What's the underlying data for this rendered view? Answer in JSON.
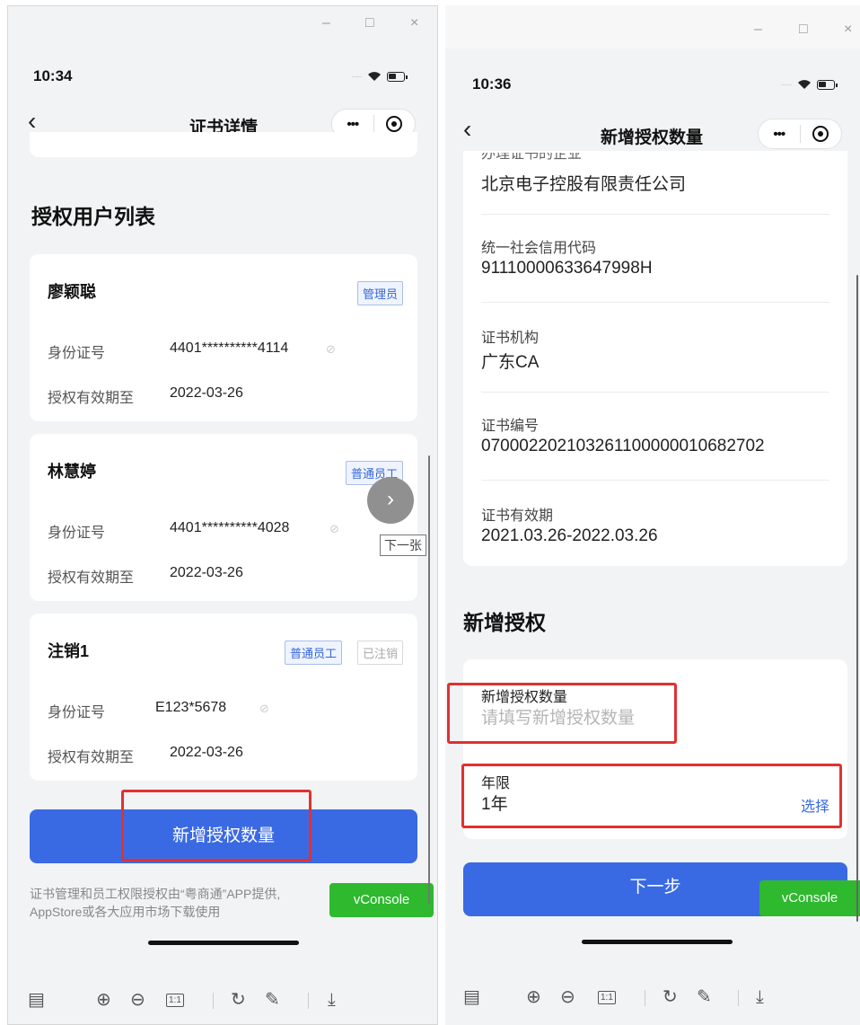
{
  "left": {
    "status_time": "10:34",
    "nav_title": "证书详情",
    "section_title": "授权用户列表",
    "users": [
      {
        "name": "廖颖聪",
        "tags": [
          {
            "text": "管理员",
            "style": "blue"
          }
        ],
        "id_label": "身份证号",
        "id_value": "4401**********4114",
        "expiry_label": "授权有效期至",
        "expiry_value": "2022-03-26"
      },
      {
        "name": "林慧婷",
        "tags": [
          {
            "text": "普通员工",
            "style": "blue"
          }
        ],
        "id_label": "身份证号",
        "id_value": "4401**********4028",
        "expiry_label": "授权有效期至",
        "expiry_value": "2022-03-26"
      },
      {
        "name": "注销1",
        "tags": [
          {
            "text": "普通员工",
            "style": "blue"
          },
          {
            "text": "已注销",
            "style": "gray"
          }
        ],
        "id_label": "身份证号",
        "id_value": "E123*5678",
        "expiry_label": "授权有效期至",
        "expiry_value": "2022-03-26"
      }
    ],
    "add_button": "新增授权数量",
    "footer_line1": "证书管理和员工权限授权由“粤商通”APP提供,",
    "footer_line2": "AppStore或各大应用市场下载使用",
    "next_tip": "下一张",
    "vconsole": "vConsole"
  },
  "right": {
    "status_time": "10:36",
    "nav_title": "新增授权数量",
    "company_label_cut": "办理证书的企业",
    "company_value": "北京电子控股有限责任公司",
    "fields": [
      {
        "label": "统一社会信用代码",
        "value": "91110000633647998H"
      },
      {
        "label": "证书机构",
        "value": "广东CA"
      },
      {
        "label": "证书编号",
        "value": "070002202103261100000010682702"
      },
      {
        "label": "证书有效期",
        "value": "2021.03.26-2022.03.26"
      }
    ],
    "section_title": "新增授权",
    "count_label": "新增授权数量",
    "count_placeholder": "请填写新增授权数量",
    "years_label": "年限",
    "years_value": "1年",
    "years_choose": "选择",
    "next_button": "下一步",
    "vconsole": "vConsole"
  },
  "window_controls": {
    "minimize": "–",
    "maximize": "□",
    "close": "×"
  },
  "toolbar_icons": [
    "thumbnail-icon",
    "zoom-in-icon",
    "zoom-out-icon",
    "actual-size-icon",
    "rotate-icon",
    "edit-icon",
    "download-icon"
  ],
  "toolbar_ratio_label": "1:1",
  "colors": {
    "primary": "#3a6ae3",
    "vconsole": "#2eb92e",
    "highlight": "#e23030"
  }
}
